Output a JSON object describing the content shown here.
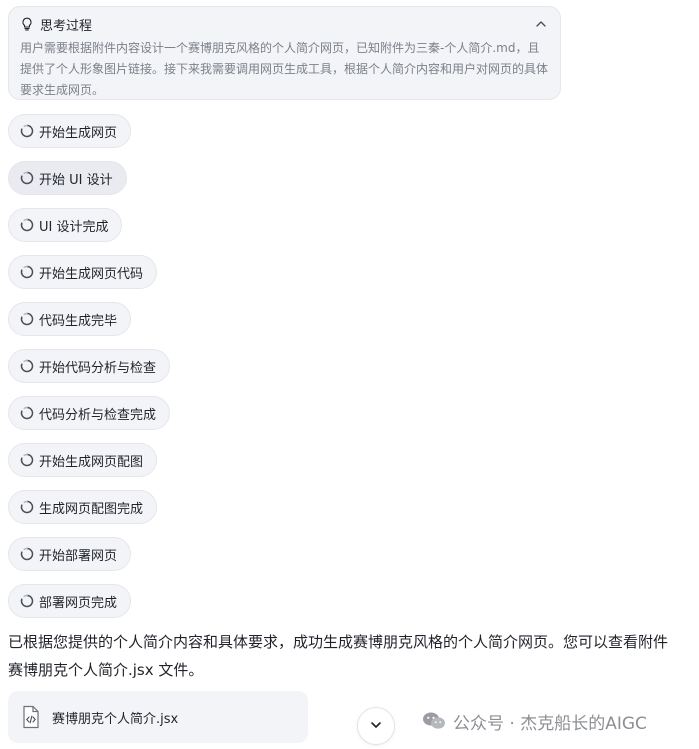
{
  "thinking": {
    "title": "思考过程",
    "body": "用户需要根据附件内容设计一个赛博朋克风格的个人简介网页，已知附件为三秦-个人简介.md，且提供了个人形象图片链接。接下来我需要调用网页生成工具，根据个人简介内容和用户对网页的具体要求生成网页。",
    "toggle_icon": "chevron-up-icon",
    "icon": "lightbulb-icon"
  },
  "steps": [
    {
      "label": "开始生成网页"
    },
    {
      "label": "开始 UI 设计"
    },
    {
      "label": "UI 设计完成"
    },
    {
      "label": "开始生成网页代码"
    },
    {
      "label": "代码生成完毕"
    },
    {
      "label": "开始代码分析与检查"
    },
    {
      "label": "代码分析与检查完成"
    },
    {
      "label": "开始生成网页配图"
    },
    {
      "label": "生成网页配图完成"
    },
    {
      "label": "开始部署网页"
    },
    {
      "label": "部署网页完成"
    }
  ],
  "result": {
    "line1": "已根据您提供的个人简介内容和具体要求，成功生成赛博朋克风格的个人简介网页。您可以查看附件",
    "line2": "赛博朋克个人简介.jsx 文件。"
  },
  "file": {
    "name": "赛博朋克个人简介.jsx",
    "icon": "code-file-icon"
  },
  "watermark": {
    "text": "公众号 · 杰克船长的AIGC",
    "icon": "wechat-icon"
  },
  "colors": {
    "panel_bg": "#f3f4f7",
    "border": "#e4e6eb",
    "muted_text": "#7b8089",
    "text": "#1f2329"
  }
}
